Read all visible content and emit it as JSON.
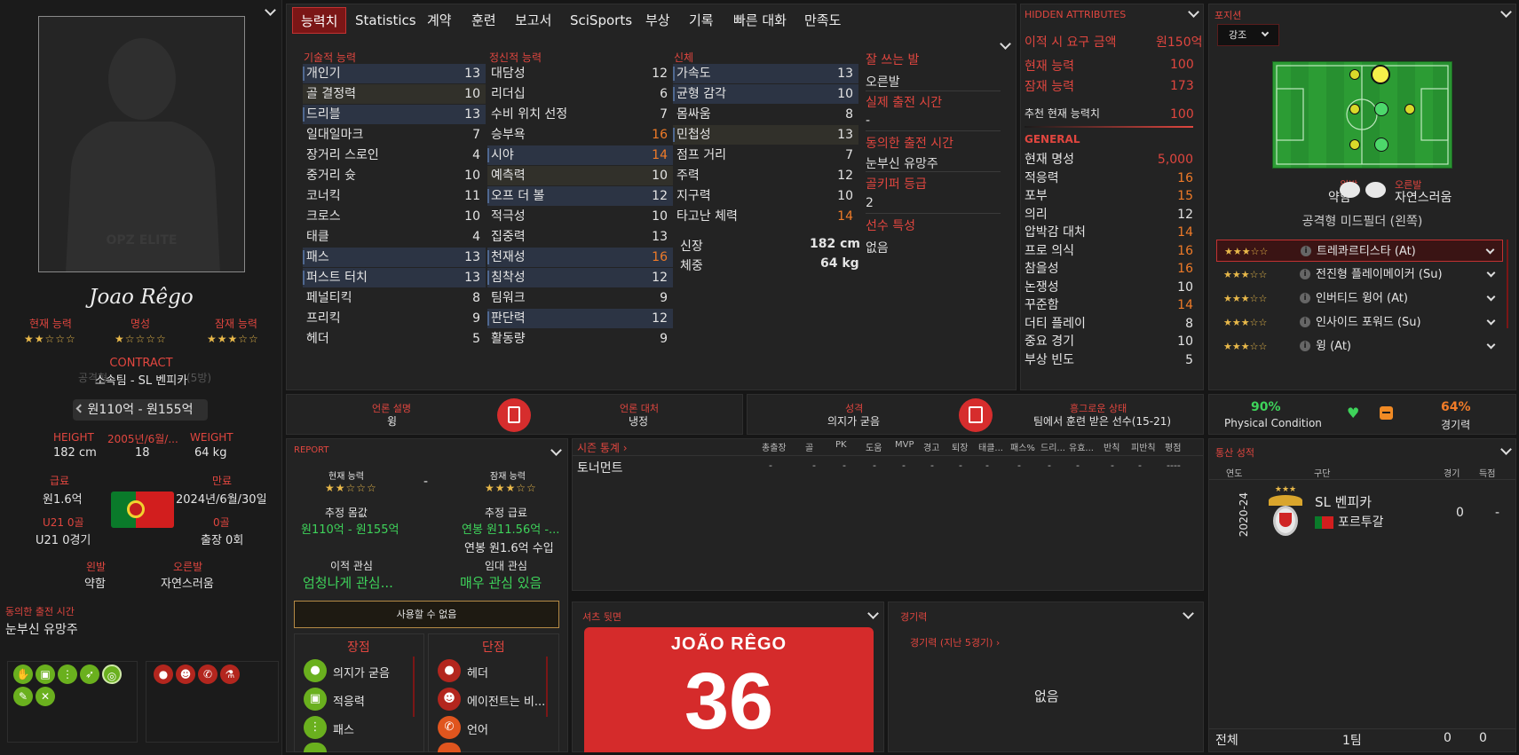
{
  "left": {
    "name": "Joao Rêgo",
    "watermark": "OPZ ELITE",
    "labels": {
      "current": "현재 능력",
      "reputation": "명성",
      "potential": "잠재 능력"
    },
    "current_stars": "★★☆☆☆",
    "reputation_stars": "★☆☆☆☆",
    "potential_stars": "★★★☆☆",
    "contract_label": "CONTRACT",
    "club_line_bg": "공격형",
    "club_line_bg2": "(5방)",
    "club_line": "소속팀 - SL 벤피카",
    "value": "원110억 - 원155억",
    "height_label": "HEIGHT",
    "height": "182 cm",
    "dob_label": "2005년/6월/...",
    "age": "18",
    "weight_label": "WEIGHT",
    "weight": "64 kg",
    "wage_label": "급료",
    "wage": "원1.6억",
    "expiry_label": "만료",
    "expiry": "2024년/6월/30일",
    "u21_label": "U21 0골",
    "u21": "U21 0경기",
    "goals_label": "0골",
    "apps": "출장 0회",
    "lfoot_label": "왼발",
    "lfoot": "약함",
    "rfoot_label": "오른발",
    "rfoot": "자연스러움",
    "playtime_label": "동의한 출전 시간",
    "playtime": "눈부신 유망주"
  },
  "tabs": [
    "능력치",
    "Statistics",
    "계약",
    "훈련",
    "보고서",
    "SciSports",
    "부상",
    "기록",
    "빠른 대화",
    "만족도"
  ],
  "attributes": {
    "technical_title": "기술적 능력",
    "mental_title": "정신적 능력",
    "physical_title": "신체",
    "technical": [
      {
        "n": "개인기",
        "v": "13"
      },
      {
        "n": "골 결정력",
        "v": "10"
      },
      {
        "n": "드리블",
        "v": "13"
      },
      {
        "n": "일대일마크",
        "v": "7"
      },
      {
        "n": "장거리 스로인",
        "v": "4"
      },
      {
        "n": "중거리 슛",
        "v": "10"
      },
      {
        "n": "코너킥",
        "v": "11"
      },
      {
        "n": "크로스",
        "v": "10"
      },
      {
        "n": "태클",
        "v": "4"
      },
      {
        "n": "패스",
        "v": "13"
      },
      {
        "n": "퍼스트 터치",
        "v": "13"
      },
      {
        "n": "페널티킥",
        "v": "8"
      },
      {
        "n": "프리킥",
        "v": "9"
      },
      {
        "n": "헤더",
        "v": "5"
      }
    ],
    "mental": [
      {
        "n": "대담성",
        "v": "12"
      },
      {
        "n": "리더십",
        "v": "6"
      },
      {
        "n": "수비 위치 선정",
        "v": "7"
      },
      {
        "n": "승부욕",
        "v": "16"
      },
      {
        "n": "시야",
        "v": "14"
      },
      {
        "n": "예측력",
        "v": "10"
      },
      {
        "n": "오프 더 볼",
        "v": "12"
      },
      {
        "n": "적극성",
        "v": "10"
      },
      {
        "n": "집중력",
        "v": "13"
      },
      {
        "n": "천재성",
        "v": "16"
      },
      {
        "n": "침착성",
        "v": "12"
      },
      {
        "n": "팀워크",
        "v": "9"
      },
      {
        "n": "판단력",
        "v": "12"
      },
      {
        "n": "활동량",
        "v": "9"
      }
    ],
    "physical": [
      {
        "n": "가속도",
        "v": "13"
      },
      {
        "n": "균형 감각",
        "v": "10"
      },
      {
        "n": "몸싸움",
        "v": "8"
      },
      {
        "n": "민첩성",
        "v": "13"
      },
      {
        "n": "점프 거리",
        "v": "7"
      },
      {
        "n": "주력",
        "v": "12"
      },
      {
        "n": "지구력",
        "v": "10"
      },
      {
        "n": "타고난 체력",
        "v": "14"
      }
    ],
    "height_label": "신장",
    "height": "182 cm",
    "weight_label": "체중",
    "weight": "64 kg"
  },
  "info": {
    "foot_title": "잘 쓰는 발",
    "foot": "오른발",
    "actual_title": "실제 출전 시간",
    "actual": "-",
    "agreed_title": "동의한 출전 시간",
    "agreed": "눈부신 유망주",
    "gk_title": "골키퍼 등급",
    "gk": "2",
    "traits_title": "선수 특성",
    "traits": "없음"
  },
  "hidden": {
    "title": "HIDDEN ATTRIBUTES",
    "fee_label": "이적 시 요구 금액",
    "fee": "원150억",
    "ca_label": "현재 능력",
    "ca": "100",
    "pa_label": "잠재 능력",
    "pa": "173",
    "rec_label": "추천 현재 능력치",
    "rec": "100",
    "general_title": "GENERAL",
    "rows": [
      {
        "n": "현재 명성",
        "v": "5,000",
        "c": "red"
      },
      {
        "n": "적응력",
        "v": "16",
        "c": "orange"
      },
      {
        "n": "포부",
        "v": "15",
        "c": "orange"
      },
      {
        "n": "의리",
        "v": "12",
        "c": ""
      },
      {
        "n": "압박감 대처",
        "v": "14",
        "c": "orange"
      },
      {
        "n": "프로 의식",
        "v": "16",
        "c": "orange"
      },
      {
        "n": "참을성",
        "v": "16",
        "c": "orange"
      },
      {
        "n": "논쟁성",
        "v": "10",
        "c": ""
      },
      {
        "n": "꾸준함",
        "v": "14",
        "c": "orange"
      },
      {
        "n": "더티 플레이",
        "v": "8",
        "c": ""
      },
      {
        "n": "중요 경기",
        "v": "10",
        "c": ""
      },
      {
        "n": "부상 빈도",
        "v": "5",
        "c": ""
      }
    ]
  },
  "position": {
    "title": "포지션",
    "dropdown": "강조",
    "lfoot_label": "왼발",
    "lfoot": "약함",
    "rfoot_label": "오른발",
    "rfoot": "자연스러움",
    "role": "공격형 미드필더 (왼쪽)",
    "roles": [
      {
        "stars": "★★★☆☆",
        "t": "트레콰르티스타 (At)"
      },
      {
        "stars": "★★★☆☆",
        "t": "전진형 플레이메이커 (Su)"
      },
      {
        "stars": "★★★☆☆",
        "t": "인버티드 윙어 (At)"
      },
      {
        "stars": "★★★☆☆",
        "t": "인사이드 포워드 (Su)"
      },
      {
        "stars": "★★★☆☆",
        "t": "윙 (At)"
      }
    ]
  },
  "mid": {
    "media_label": "언론 설명",
    "media": "윙",
    "media_handling_label": "언론 대처",
    "media_handling": "냉정",
    "personality_label": "성격",
    "personality": "의지가 굳음",
    "status_label": "흥그로운 상태",
    "status": "팀에서 훈련 받은 선수(15-21)",
    "condition": "90%",
    "condition_label": "Physical Condition",
    "sharpness": "64%",
    "sharpness_label": "경기력"
  },
  "report": {
    "title": "REPORT",
    "ca_label": "현재 능력",
    "pa_label": "잠재 능력",
    "ca_stars": "★★☆☆☆",
    "pa_stars": "★★★☆☆",
    "dash": "-",
    "val_label": "추정 몸값",
    "val": "원110억 - 원155억",
    "wage_label": "추정 급료",
    "wage": "연봉 원11.56억 -...",
    "wage2": "연봉 원1.6억 수입",
    "transfer_label": "이적 관심",
    "transfer": "엄청나게 관심...",
    "loan_label": "임대 관심",
    "loan": "매우 관심 있음",
    "button": "사용할 수 없음",
    "pros_title": "장점",
    "cons_title": "단점",
    "pros": [
      "의지가 굳음",
      "적응력",
      "패스"
    ],
    "cons": [
      "헤더",
      "에이전트는 비...",
      "언어"
    ]
  },
  "season": {
    "title": "시즌 통계 ›",
    "cols": [
      "총출장",
      "골",
      "PK",
      "도움",
      "MVP",
      "경고",
      "퇴장",
      "태클...",
      "패스%",
      "드리...",
      "유효...",
      "반칙",
      "피반칙",
      "평점"
    ],
    "row_label": "토너먼트",
    "row_vals": [
      "-",
      "-",
      "-",
      "-",
      "-",
      "-",
      "-",
      "-",
      "-",
      "-",
      "-",
      "-",
      "-",
      "----"
    ]
  },
  "shirt": {
    "title": "셔츠 뒷면",
    "name": "JOÃO RÊGO",
    "number": "36"
  },
  "form": {
    "title": "경기력",
    "link": "경기력 (지난 5경기) ›",
    "none": "없음"
  },
  "career": {
    "title": "통산 성적",
    "col_year": "연도",
    "col_club": "구단",
    "col_apps": "경기",
    "col_goals": "득점",
    "year": "2020-24",
    "club": "SL 벤피카",
    "country": "포르투갈",
    "apps": "0",
    "goals": "-",
    "total_label": "전체",
    "total_team": "1팀",
    "total_apps": "0",
    "total_goals": "0"
  }
}
